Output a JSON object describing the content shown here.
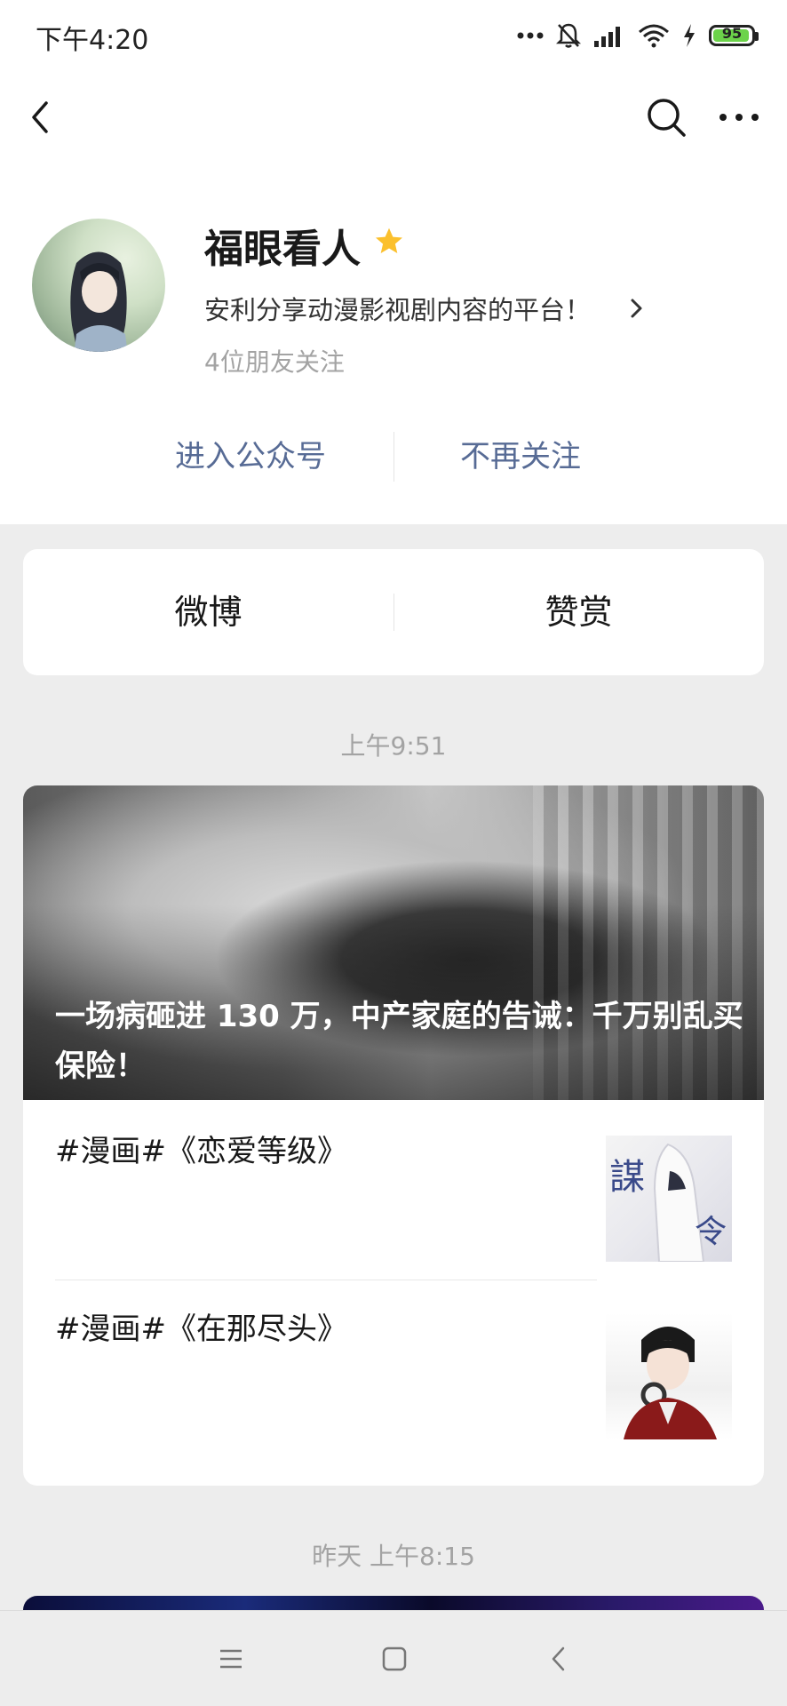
{
  "status_bar": {
    "time": "下午4:20",
    "battery": "95",
    "battery_level": 0.95,
    "icons": [
      "more-dots-icon",
      "mute-bell-icon",
      "signal-icon",
      "wifi-icon",
      "charging-icon",
      "battery-icon"
    ]
  },
  "nav": {
    "back_icon": "back-chevron-icon",
    "search_icon": "search-icon",
    "more_icon": "more-dots-icon"
  },
  "profile": {
    "name": "福眼看人",
    "description": "安利分享动漫影视剧内容的平台！",
    "friends_following": "4位朋友关注",
    "enter_label": "进入公众号",
    "unfollow_label": "不再关注",
    "star_color": "#fbc02d"
  },
  "menu": {
    "items": [
      {
        "label": "微博"
      },
      {
        "label": "赞赏"
      }
    ]
  },
  "feed": {
    "groups": [
      {
        "timestamp": "上午9:51",
        "cover_title": "一场病砸进 130 万，中产家庭的告诫：千万别乱买保险！",
        "items": [
          {
            "title": "#漫画#《恋爱等级》"
          },
          {
            "title": "#漫画#《在那尽头》"
          }
        ]
      },
      {
        "timestamp": "昨天 上午8:15"
      }
    ]
  },
  "colors": {
    "link": "#576b95",
    "background": "#ededed",
    "secondary_text": "#a3a3a3"
  }
}
